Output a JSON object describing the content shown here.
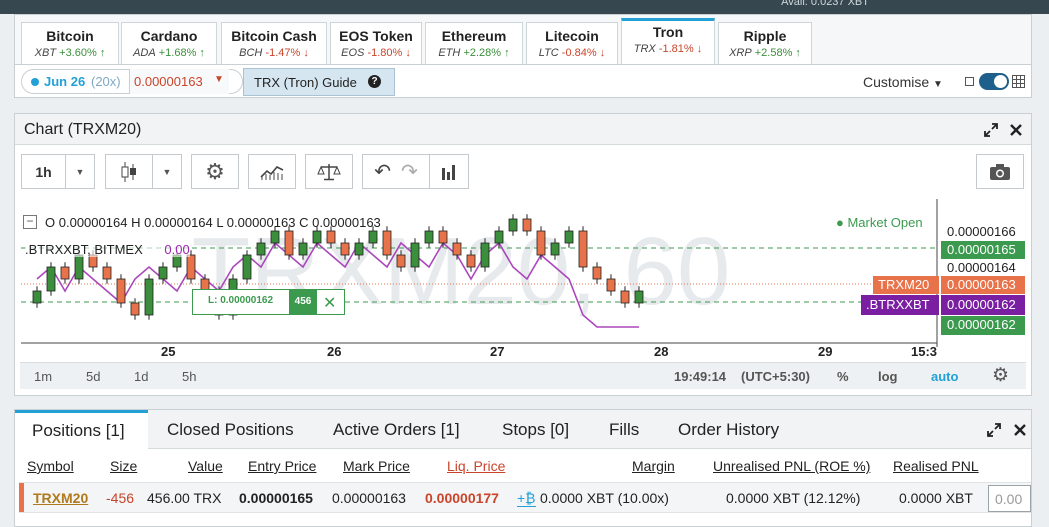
{
  "top_strip": {
    "text": "Avail: 0.0237 XBT"
  },
  "tickers": [
    {
      "name": "Bitcoin",
      "symbol": "XBT",
      "change": "+3.60%",
      "dir": "up"
    },
    {
      "name": "Cardano",
      "symbol": "ADA",
      "change": "+1.68%",
      "dir": "up"
    },
    {
      "name": "Bitcoin Cash",
      "symbol": "BCH",
      "change": "-1.47%",
      "dir": "down"
    },
    {
      "name": "EOS Token",
      "symbol": "EOS",
      "change": "-1.80%",
      "dir": "down"
    },
    {
      "name": "Ethereum",
      "symbol": "ETH",
      "change": "+2.28%",
      "dir": "up"
    },
    {
      "name": "Litecoin",
      "symbol": "LTC",
      "change": "-0.84%",
      "dir": "down"
    },
    {
      "name": "Tron",
      "symbol": "TRX",
      "change": "-1.81%",
      "dir": "down"
    },
    {
      "name": "Ripple",
      "symbol": "XRP",
      "change": "+2.58%",
      "dir": "up"
    }
  ],
  "contract": {
    "date": "Jun 26",
    "leverage": "(20x)",
    "price": "0.00000163",
    "guide": "TRX (Tron) Guide",
    "customise": "Customise"
  },
  "chart": {
    "title": "Chart (TRXM20)",
    "interval": "1h",
    "watermark": "TRXM20, 60",
    "ohlc": {
      "o_label": "O",
      "o": "0.00000164",
      "h_label": "H",
      "h": "0.00000164",
      "l_label": "L",
      "l": "0.00000163",
      "c_label": "C",
      "c": "0.00000163"
    },
    "comparison_label": ".BTRXXBT, BITMEX",
    "comparison_value": "0.00",
    "market_status": "Market Open",
    "order_line": {
      "label": "L: 0.00000162",
      "qty": "456"
    },
    "price_axis": [
      "0.00000166",
      "0.00000165",
      "0.00000164",
      "0.00000163",
      "0.00000162",
      "0.00000162"
    ],
    "price_tags": {
      "trxm20": "TRXM20",
      "btrxxbt": ".BTRXXBT"
    },
    "time_axis": [
      "25",
      "26",
      "27",
      "28",
      "29",
      "15:3"
    ],
    "ranges": [
      "1m",
      "5d",
      "1d",
      "5h"
    ],
    "clock": "19:49:14",
    "timezone": "(UTC+5:30)",
    "percent": "%",
    "log": "log",
    "auto": "auto"
  },
  "chart_data": {
    "type": "candlestick",
    "title": "TRXM20, 60",
    "series": [
      {
        "name": "TRXM20",
        "values": [
          1.635,
          1.645,
          1.64,
          1.65,
          1.645,
          1.64,
          1.63,
          1.625,
          1.64,
          1.645,
          1.65,
          1.64,
          1.635,
          1.625,
          1.64,
          1.65,
          1.655,
          1.66,
          1.65,
          1.655,
          1.66,
          1.655,
          1.65,
          1.655,
          1.66,
          1.65,
          1.645,
          1.655,
          1.66,
          1.655,
          1.65,
          1.645,
          1.655,
          1.66,
          1.665,
          1.66,
          1.65,
          1.655,
          1.66,
          1.645,
          1.64,
          1.635,
          1.63,
          1.635
        ]
      },
      {
        "name": ".BTRXXBT",
        "values": [
          1.64,
          1.645,
          1.635,
          1.645,
          1.64,
          1.635,
          1.63,
          1.64,
          1.645,
          1.64,
          1.635,
          1.645,
          1.64,
          1.635,
          1.645,
          1.65,
          1.645,
          1.655,
          1.65,
          1.645,
          1.655,
          1.65,
          1.645,
          1.655,
          1.65,
          1.645,
          1.655,
          1.65,
          1.645,
          1.655,
          1.65,
          1.64,
          1.65,
          1.655,
          1.645,
          1.64,
          1.65,
          1.645,
          1.64,
          1.625,
          1.62,
          1.62,
          1.62,
          1.62
        ]
      }
    ],
    "y_unit": "1e-6",
    "ylim": [
      1.615,
      1.67
    ]
  },
  "positions": {
    "tabs": [
      "Positions [1]",
      "Closed Positions",
      "Active Orders [1]",
      "Stops [0]",
      "Fills",
      "Order History"
    ],
    "headers": [
      "Symbol",
      "Size",
      "Value",
      "Entry Price",
      "Mark Price",
      "Liq. Price",
      "Margin",
      "Unrealised PNL (ROE %)",
      "Realised PNL"
    ],
    "row": {
      "symbol": "TRXM20",
      "size": "-456",
      "value": "456.00 TRX",
      "entry": "0.00000165",
      "mark": "0.00000163",
      "liq": "0.00000177",
      "margin_icon": "+₿",
      "margin": "0.0000 XBT (10.00x)",
      "upnl": "0.0000 XBT (12.12%)",
      "rpnl": "0.0000 XBT",
      "input": "0.00"
    }
  },
  "colors": {
    "up": "#3b8e3b",
    "down": "#c9442a",
    "accent": "#23a0d6",
    "tag_orange": "#e8734a",
    "tag_purple": "#7b1fa2",
    "tag_green": "#3c9a4f"
  }
}
